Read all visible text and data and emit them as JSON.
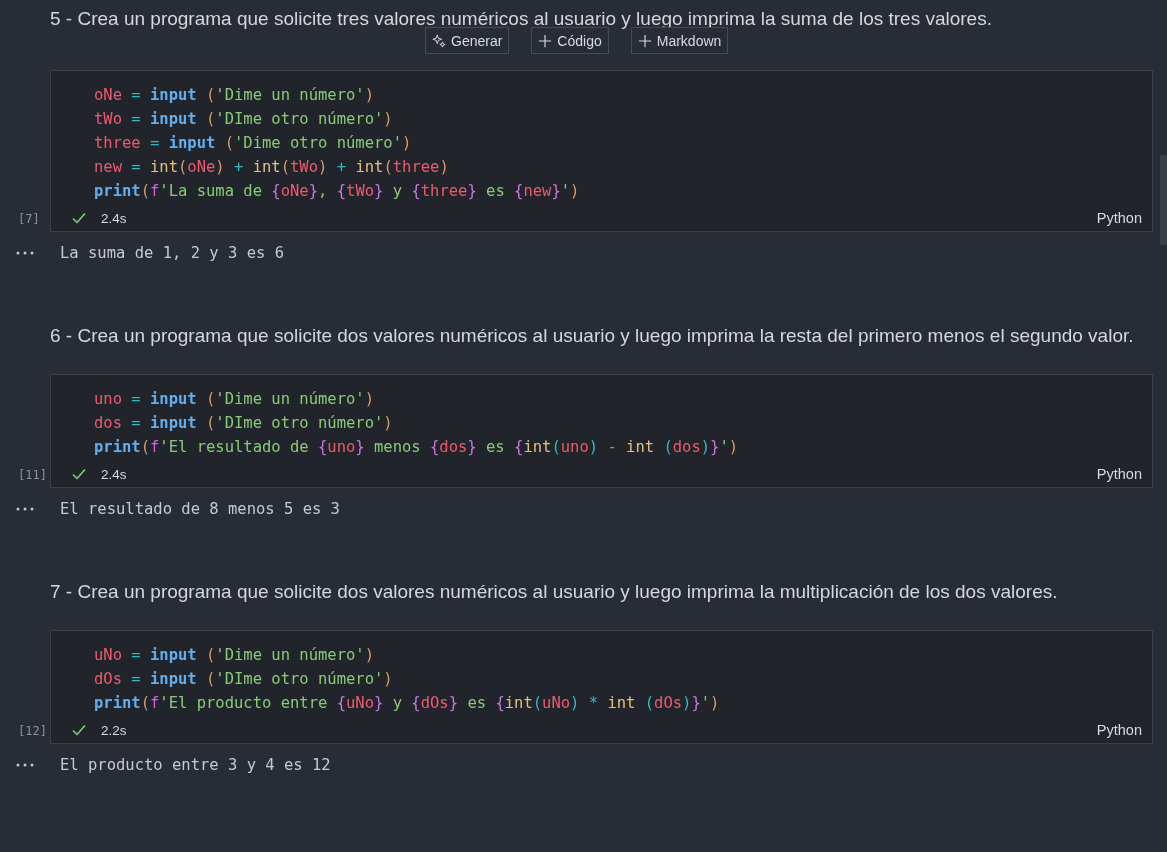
{
  "cells": [
    {
      "kind": "markdown",
      "text": "5 - Crea un programa que solicite tres valores numéricos al usuario y luego imprima la suma de los tres valores.",
      "toolbar": [
        "Generar",
        "Código",
        "Markdown"
      ]
    },
    {
      "kind": "code",
      "count": "[7]",
      "time": "2.4s",
      "language": "Python",
      "output": "La suma de 1, 2 y 3 es 6",
      "lines": [
        [
          {
            "kind": "var",
            "t": "oNe"
          },
          {
            "kind": "op",
            "t": " = "
          },
          {
            "kind": "kw",
            "t": "input "
          },
          {
            "kind": "paren",
            "t": "("
          },
          {
            "kind": "str",
            "t": "'Dime un número'"
          },
          {
            "kind": "paren",
            "t": ")"
          }
        ],
        [
          {
            "kind": "var",
            "t": "tWo"
          },
          {
            "kind": "op",
            "t": " = "
          },
          {
            "kind": "kw",
            "t": "input "
          },
          {
            "kind": "paren",
            "t": "("
          },
          {
            "kind": "str",
            "t": "'DIme otro número'"
          },
          {
            "kind": "paren",
            "t": ")"
          }
        ],
        [
          {
            "kind": "var",
            "t": "three"
          },
          {
            "kind": "op",
            "t": " = "
          },
          {
            "kind": "kw",
            "t": "input "
          },
          {
            "kind": "paren",
            "t": "("
          },
          {
            "kind": "str",
            "t": "'Dime otro número'"
          },
          {
            "kind": "paren",
            "t": ")"
          }
        ],
        [
          {
            "kind": "var",
            "t": "new"
          },
          {
            "kind": "op",
            "t": " = "
          },
          {
            "kind": "fn",
            "t": "int"
          },
          {
            "kind": "paren",
            "t": "("
          },
          {
            "kind": "var",
            "t": "oNe"
          },
          {
            "kind": "paren",
            "t": ")"
          },
          {
            "kind": "op",
            "t": " + "
          },
          {
            "kind": "fn",
            "t": "int"
          },
          {
            "kind": "paren",
            "t": "("
          },
          {
            "kind": "var",
            "t": "tWo"
          },
          {
            "kind": "paren",
            "t": ")"
          },
          {
            "kind": "op",
            "t": " + "
          },
          {
            "kind": "fn",
            "t": "int"
          },
          {
            "kind": "paren",
            "t": "("
          },
          {
            "kind": "var",
            "t": "three"
          },
          {
            "kind": "paren",
            "t": ")"
          }
        ],
        [
          {
            "kind": "kw",
            "t": "print"
          },
          {
            "kind": "paren",
            "t": "("
          },
          {
            "kind": "fpre",
            "t": "f"
          },
          {
            "kind": "str",
            "t": "'La suma de "
          },
          {
            "kind": "brace",
            "t": "{"
          },
          {
            "kind": "var",
            "t": "oNe"
          },
          {
            "kind": "brace",
            "t": "}"
          },
          {
            "kind": "str",
            "t": ", "
          },
          {
            "kind": "brace",
            "t": "{"
          },
          {
            "kind": "var",
            "t": "tWo"
          },
          {
            "kind": "brace",
            "t": "}"
          },
          {
            "kind": "str",
            "t": " y "
          },
          {
            "kind": "brace",
            "t": "{"
          },
          {
            "kind": "var",
            "t": "three"
          },
          {
            "kind": "brace",
            "t": "}"
          },
          {
            "kind": "str",
            "t": " es "
          },
          {
            "kind": "brace",
            "t": "{"
          },
          {
            "kind": "var",
            "t": "new"
          },
          {
            "kind": "brace",
            "t": "}"
          },
          {
            "kind": "str",
            "t": "'"
          },
          {
            "kind": "paren",
            "t": ")"
          }
        ]
      ]
    },
    {
      "kind": "markdown",
      "text": "6 - Crea un programa que solicite dos valores numéricos al usuario y luego imprima la resta del primero menos el segundo valor."
    },
    {
      "kind": "code",
      "count": "[11]",
      "time": "2.4s",
      "language": "Python",
      "output": "El resultado de 8 menos 5 es 3",
      "lines": [
        [
          {
            "kind": "var",
            "t": "uno"
          },
          {
            "kind": "op",
            "t": " = "
          },
          {
            "kind": "kw",
            "t": "input "
          },
          {
            "kind": "paren",
            "t": "("
          },
          {
            "kind": "str",
            "t": "'Dime un número'"
          },
          {
            "kind": "paren",
            "t": ")"
          }
        ],
        [
          {
            "kind": "var",
            "t": "dos"
          },
          {
            "kind": "op",
            "t": " = "
          },
          {
            "kind": "kw",
            "t": "input "
          },
          {
            "kind": "paren",
            "t": "("
          },
          {
            "kind": "str",
            "t": "'DIme otro número'"
          },
          {
            "kind": "paren",
            "t": ")"
          }
        ],
        [
          {
            "kind": "kw",
            "t": "print"
          },
          {
            "kind": "paren",
            "t": "("
          },
          {
            "kind": "fpre",
            "t": "f"
          },
          {
            "kind": "str",
            "t": "'El resultado de "
          },
          {
            "kind": "brace",
            "t": "{"
          },
          {
            "kind": "var",
            "t": "uno"
          },
          {
            "kind": "brace",
            "t": "}"
          },
          {
            "kind": "str",
            "t": " menos "
          },
          {
            "kind": "brace",
            "t": "{"
          },
          {
            "kind": "var",
            "t": "dos"
          },
          {
            "kind": "brace",
            "t": "}"
          },
          {
            "kind": "str",
            "t": " es "
          },
          {
            "kind": "brace",
            "t": "{"
          },
          {
            "kind": "fn",
            "t": "int"
          },
          {
            "kind": "op",
            "t": "("
          },
          {
            "kind": "var",
            "t": "uno"
          },
          {
            "kind": "op",
            "t": ") - "
          },
          {
            "kind": "fn",
            "t": "int "
          },
          {
            "kind": "op",
            "t": "("
          },
          {
            "kind": "var",
            "t": "dos"
          },
          {
            "kind": "op",
            "t": ")"
          },
          {
            "kind": "brace",
            "t": "}"
          },
          {
            "kind": "str",
            "t": "'"
          },
          {
            "kind": "paren",
            "t": ")"
          }
        ]
      ]
    },
    {
      "kind": "markdown",
      "text": "7 - Crea un programa que solicite dos valores numéricos al usuario y luego imprima la multiplicación de los dos valores."
    },
    {
      "kind": "code",
      "count": "[12]",
      "time": "2.2s",
      "language": "Python",
      "output": "El producto entre 3 y 4 es 12",
      "lines": [
        [
          {
            "kind": "var",
            "t": "uNo"
          },
          {
            "kind": "op",
            "t": " = "
          },
          {
            "kind": "kw",
            "t": "input "
          },
          {
            "kind": "paren",
            "t": "("
          },
          {
            "kind": "str",
            "t": "'Dime un número'"
          },
          {
            "kind": "paren",
            "t": ")"
          }
        ],
        [
          {
            "kind": "var",
            "t": "dOs"
          },
          {
            "kind": "op",
            "t": " = "
          },
          {
            "kind": "kw",
            "t": "input "
          },
          {
            "kind": "paren",
            "t": "("
          },
          {
            "kind": "str",
            "t": "'DIme otro número'"
          },
          {
            "kind": "paren",
            "t": ")"
          }
        ],
        [
          {
            "kind": "kw",
            "t": "print"
          },
          {
            "kind": "paren",
            "t": "("
          },
          {
            "kind": "fpre",
            "t": "f"
          },
          {
            "kind": "str",
            "t": "'El producto entre "
          },
          {
            "kind": "brace",
            "t": "{"
          },
          {
            "kind": "var",
            "t": "uNo"
          },
          {
            "kind": "brace",
            "t": "}"
          },
          {
            "kind": "str",
            "t": " y "
          },
          {
            "kind": "brace",
            "t": "{"
          },
          {
            "kind": "var",
            "t": "dOs"
          },
          {
            "kind": "brace",
            "t": "}"
          },
          {
            "kind": "str",
            "t": " es "
          },
          {
            "kind": "brace",
            "t": "{"
          },
          {
            "kind": "fn",
            "t": "int"
          },
          {
            "kind": "op",
            "t": "("
          },
          {
            "kind": "var",
            "t": "uNo"
          },
          {
            "kind": "op",
            "t": ") * "
          },
          {
            "kind": "fn",
            "t": "int "
          },
          {
            "kind": "op",
            "t": "("
          },
          {
            "kind": "var",
            "t": "dOs"
          },
          {
            "kind": "op",
            "t": ")"
          },
          {
            "kind": "brace",
            "t": "}"
          },
          {
            "kind": "str",
            "t": "'"
          },
          {
            "kind": "paren",
            "t": ")"
          }
        ]
      ]
    }
  ]
}
